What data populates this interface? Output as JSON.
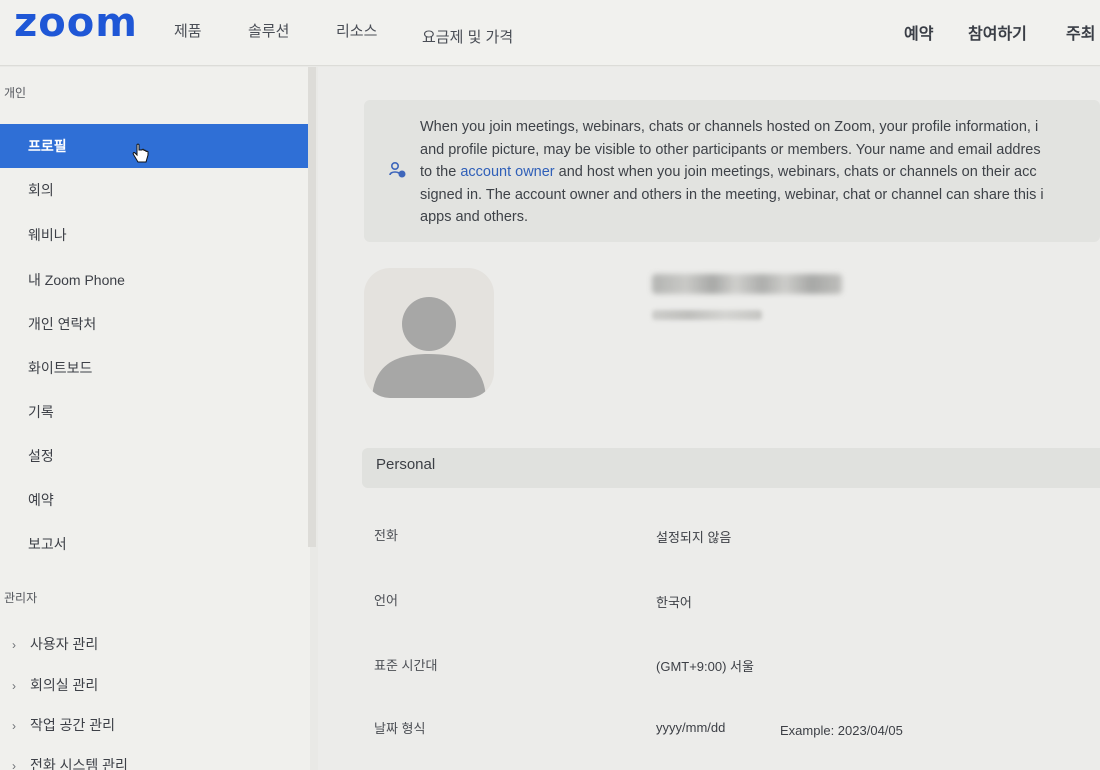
{
  "header": {
    "logo": "zoom",
    "nav": [
      "제품",
      "솔루션",
      "리소스",
      "요금제 및 가격"
    ],
    "right": [
      "예약",
      "참여하기",
      "주최"
    ]
  },
  "sidebar": {
    "personal_heading": "개인",
    "items": [
      "프로필",
      "회의",
      "웨비나",
      "내 Zoom Phone",
      "개인 연락처",
      "화이트보드",
      "기록",
      "설정",
      "예약",
      "보고서"
    ],
    "admin_heading": "관리자",
    "admin_items": [
      "사용자 관리",
      "회의실 관리",
      "작업 공간 관리",
      "전화 시스템 관리"
    ]
  },
  "notice": {
    "line1": "When you join meetings, webinars, chats or channels hosted on Zoom, your profile information, i",
    "line2": "and profile picture, may be visible to other participants or members. Your name and email addres",
    "line3_pre": "to the ",
    "line3_link": "account owner",
    "line3_post": " and host when you join meetings, webinars, chats or channels on their acc",
    "line4": "signed in. The account owner and others in the meeting, webinar, chat or channel can share this i",
    "line5": "apps and others."
  },
  "profile": {
    "section_title": "Personal",
    "rows": [
      {
        "label": "전화",
        "value": "설정되지 않음"
      },
      {
        "label": "언어",
        "value": "한국어"
      },
      {
        "label": "표준 시간대",
        "value": "(GMT+9:00) 서울"
      },
      {
        "label": "날짜 형식",
        "value": "yyyy/mm/dd",
        "extra": "Example: 2023/04/05"
      }
    ]
  }
}
